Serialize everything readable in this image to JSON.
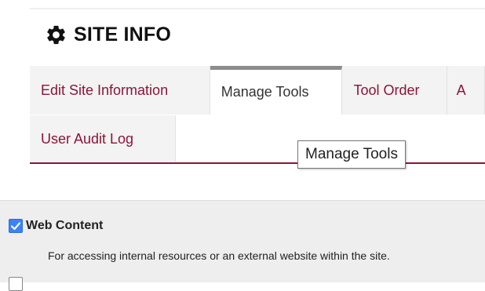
{
  "header": {
    "title": "SITE INFO",
    "icon": "gear-icon"
  },
  "tabs": [
    {
      "label": "Edit Site Information",
      "active": false
    },
    {
      "label": "Manage Tools",
      "active": true
    },
    {
      "label": "Tool Order",
      "active": false
    },
    {
      "label": "A",
      "active": false
    }
  ],
  "tabs_row2": [
    {
      "label": "User Audit Log"
    }
  ],
  "tooltip": {
    "text": "Manage Tools"
  },
  "tools": [
    {
      "name": "Web Content",
      "checked": true,
      "description": "For accessing internal resources or an external website within the site."
    }
  ],
  "colors": {
    "accent": "#8a1538",
    "checkbox": "#3b82f6",
    "panel": "#eeeeee"
  }
}
